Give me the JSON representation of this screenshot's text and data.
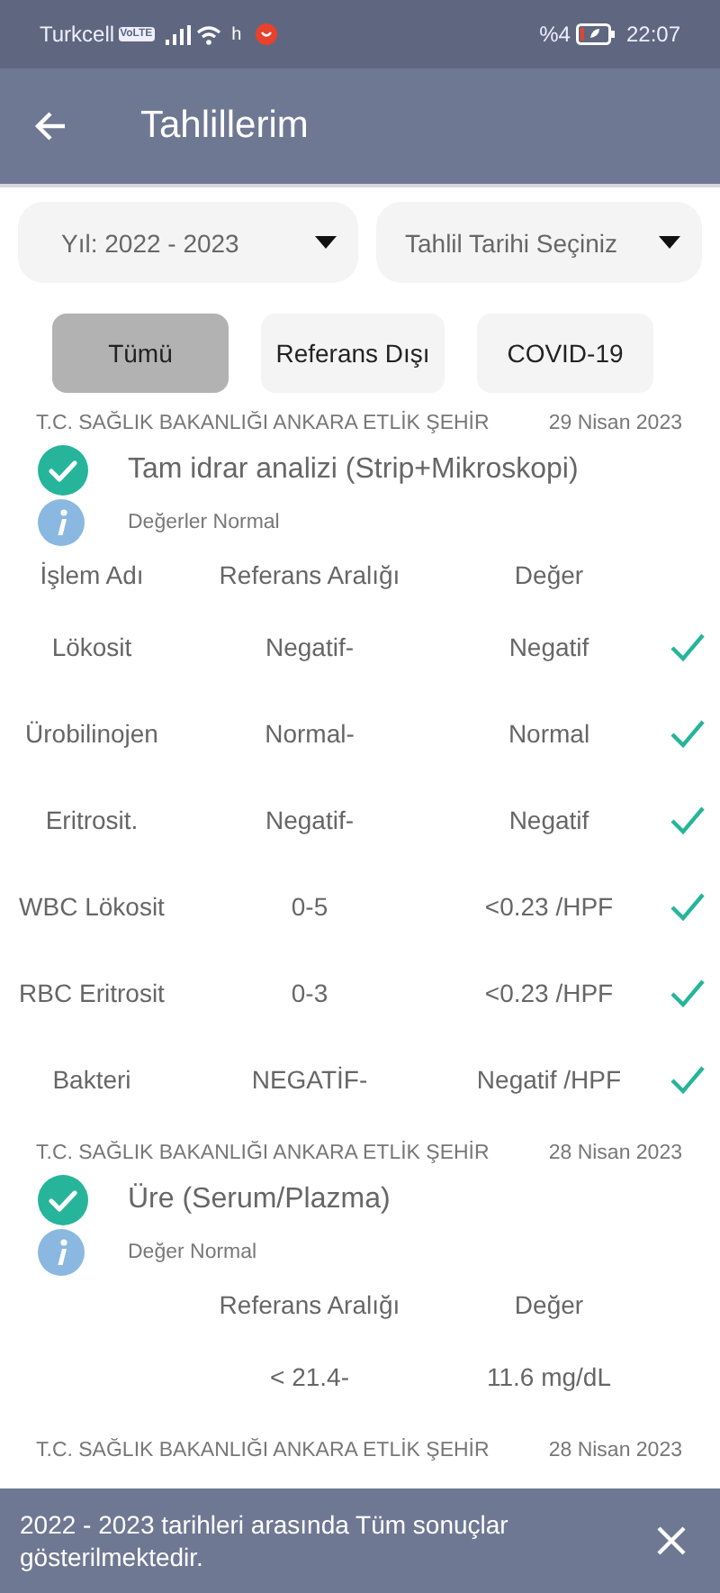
{
  "status_bar": {
    "carrier": "Turkcell",
    "network_badge": "VoLTE",
    "data_label": "h",
    "battery": "%4",
    "time": "22:07"
  },
  "app_bar": {
    "title": "Tahlillerim"
  },
  "dropdowns": [
    {
      "value": "Yıl: 2022 - 2023"
    },
    {
      "value": "Tahlil Tarihi Seçiniz"
    }
  ],
  "filters": [
    {
      "label": "Tümü",
      "selected": true
    },
    {
      "label": "Referans Dışı",
      "selected": false
    },
    {
      "label": "COVID-19",
      "selected": false
    }
  ],
  "groups": [
    {
      "hospital": "T.C. SAĞLIK BAKANLIĞI ANKARA ETLİK ŞEHİR",
      "date": "29 Nisan 2023",
      "title": "Tam idrar analizi (Strip+Mikroskopi)",
      "kind": "normal",
      "note": "Değerler Normal",
      "columns": {
        "name": "İşlem Adı",
        "range": "Referans Aralığı",
        "value": "Değer"
      },
      "rows": [
        {
          "name": "Lökosit",
          "range": "Negatif-",
          "value": "Negatif",
          "ok": true
        },
        {
          "name": "Ürobilinojen",
          "range": "Normal-",
          "value": "Normal",
          "ok": true
        },
        {
          "name": "Eritrosit.",
          "range": "Negatif-",
          "value": "Negatif",
          "ok": true
        },
        {
          "name": "WBC Lökosit",
          "range": "0-5",
          "value": "<0.23 /HPF",
          "ok": true
        },
        {
          "name": "RBC Eritrosit",
          "range": "0-3",
          "value": "<0.23 /HPF",
          "ok": true
        },
        {
          "name": "Bakteri",
          "range": "NEGATİF-",
          "value": "Negatif /HPF",
          "ok": true
        }
      ]
    },
    {
      "hospital": "T.C. SAĞLIK BAKANLIĞI ANKARA ETLİK ŞEHİR",
      "date": "28 Nisan 2023",
      "title": "Üre (Serum/Plazma)",
      "kind": "normal",
      "note": "Değer Normal",
      "columns": {
        "range": "Referans Aralığı",
        "value": "Değer"
      },
      "rows": [
        {
          "range": "< 21.4-",
          "value": "11.6 mg/dL",
          "ok": false
        }
      ]
    },
    {
      "hospital": "T.C. SAĞLIK BAKANLIĞI ANKARA ETLİK ŞEHİR",
      "date": "28 Nisan 2023"
    }
  ],
  "snackbar": {
    "message": "2022 - 2023 tarihleri arasında Tüm sonuçlar gösterilmektedir."
  }
}
